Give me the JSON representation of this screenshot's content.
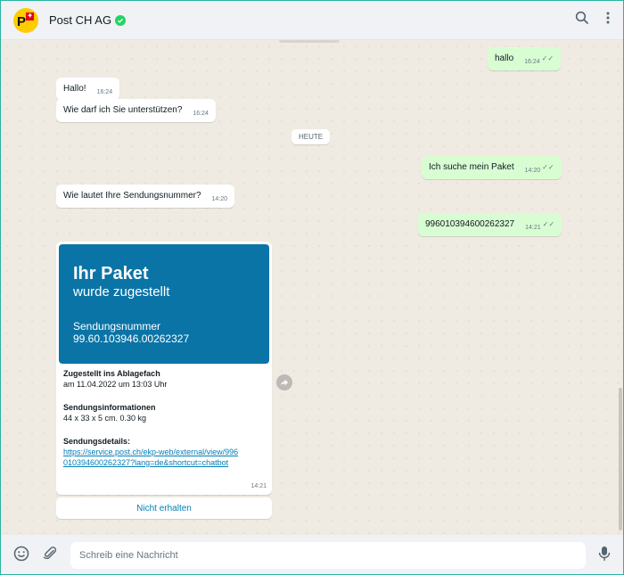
{
  "header": {
    "title": "Post CH AG",
    "avatar_text": "P",
    "icons": [
      "verified-icon",
      "search-icon",
      "menu-icon"
    ]
  },
  "messages": [
    {
      "direction": "out",
      "text": "hallo",
      "time": "16:24"
    },
    {
      "direction": "in",
      "text": "Hallo!",
      "time": "16:24"
    },
    {
      "direction": "in",
      "text": "Wie darf ich Sie unterstützen?",
      "time": "16:24"
    },
    {
      "direction": "out",
      "text": "Ich suche mein Paket",
      "time": "14:20"
    },
    {
      "direction": "in",
      "text": "Wie lautet Ihre Sendungsnummer?",
      "time": "14:20"
    },
    {
      "direction": "out",
      "text": "996010394600262327",
      "time": "14:21"
    }
  ],
  "date_chip": "HEUTE",
  "card": {
    "hero_title": "Ihr Paket",
    "hero_subtitle": "wurde zugestellt",
    "hero_label": "Sendungsnummer",
    "hero_number": "99.60.103946.00262327",
    "status_heading": "Zugestellt ins Ablagefach",
    "status_text": "am 11.04.2022 um 13:03 Uhr",
    "info_heading": "Sendungsinformationen",
    "info_text": "44 x 33 x 5 cm. 0.30 kg",
    "details_heading": "Sendungsdetails:",
    "details_link": "https://service.post.ch/ekp-web/external/view/996010394600262327?lang=de&shortcut=chatbot",
    "time": "14:21",
    "action_label": "Nicht erhalten"
  },
  "composer": {
    "placeholder": "Schreib eine Nachricht"
  },
  "colors": {
    "outgoing_bubble": "#d9fdd3",
    "incoming_bubble": "#ffffff",
    "card_hero": "#0b74a6",
    "link": "#027eb5",
    "avatar": "#ffcc00",
    "verified": "#25d366"
  }
}
